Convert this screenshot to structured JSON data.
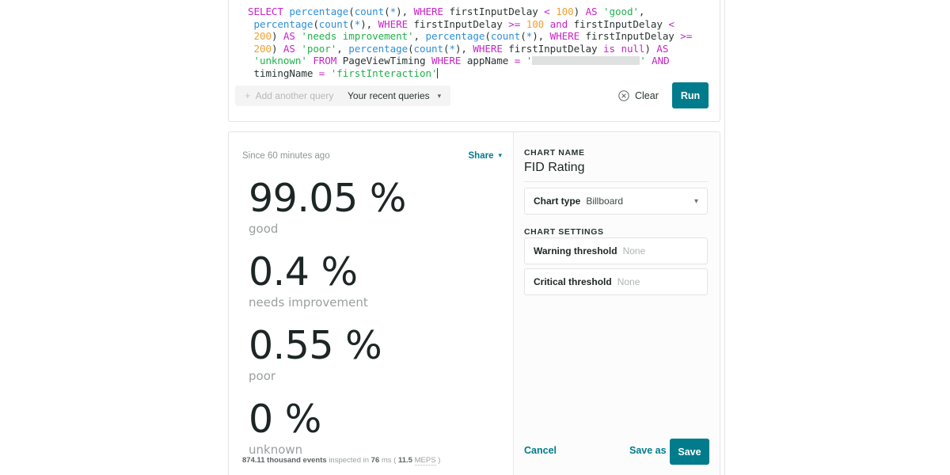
{
  "query_editor": {
    "code_tokens": [
      {
        "t": "SELECT",
        "c": "kw"
      },
      {
        "t": " ",
        "c": "plain"
      },
      {
        "t": "percentage",
        "c": "fn"
      },
      {
        "t": "(",
        "c": "plain"
      },
      {
        "t": "count",
        "c": "fn"
      },
      {
        "t": "(",
        "c": "plain"
      },
      {
        "t": "*",
        "c": "star"
      },
      {
        "t": "), ",
        "c": "plain"
      },
      {
        "t": "WHERE",
        "c": "kw"
      },
      {
        "t": " firstInputDelay ",
        "c": "plain"
      },
      {
        "t": "<",
        "c": "op"
      },
      {
        "t": " ",
        "c": "plain"
      },
      {
        "t": "100",
        "c": "num"
      },
      {
        "t": ") ",
        "c": "plain"
      },
      {
        "t": "AS",
        "c": "kw"
      },
      {
        "t": " ",
        "c": "plain"
      },
      {
        "t": "'good'",
        "c": "str"
      },
      {
        "t": ",\n ",
        "c": "plain"
      },
      {
        "t": "percentage",
        "c": "fn"
      },
      {
        "t": "(",
        "c": "plain"
      },
      {
        "t": "count",
        "c": "fn"
      },
      {
        "t": "(",
        "c": "plain"
      },
      {
        "t": "*",
        "c": "star"
      },
      {
        "t": "), ",
        "c": "plain"
      },
      {
        "t": "WHERE",
        "c": "kw"
      },
      {
        "t": " firstInputDelay ",
        "c": "plain"
      },
      {
        "t": ">=",
        "c": "op"
      },
      {
        "t": " ",
        "c": "plain"
      },
      {
        "t": "100",
        "c": "num"
      },
      {
        "t": " and",
        "c": "kw"
      },
      {
        "t": " firstInputDelay ",
        "c": "plain"
      },
      {
        "t": "<",
        "c": "op"
      },
      {
        "t": "\n ",
        "c": "plain"
      },
      {
        "t": "200",
        "c": "num"
      },
      {
        "t": ") ",
        "c": "plain"
      },
      {
        "t": "AS",
        "c": "kw"
      },
      {
        "t": " ",
        "c": "plain"
      },
      {
        "t": "'needs improvement'",
        "c": "str"
      },
      {
        "t": ", ",
        "c": "plain"
      },
      {
        "t": "percentage",
        "c": "fn"
      },
      {
        "t": "(",
        "c": "plain"
      },
      {
        "t": "count",
        "c": "fn"
      },
      {
        "t": "(",
        "c": "plain"
      },
      {
        "t": "*",
        "c": "star"
      },
      {
        "t": "), ",
        "c": "plain"
      },
      {
        "t": "WHERE",
        "c": "kw"
      },
      {
        "t": " firstInputDelay ",
        "c": "plain"
      },
      {
        "t": ">=",
        "c": "op"
      },
      {
        "t": "\n ",
        "c": "plain"
      },
      {
        "t": "200",
        "c": "num"
      },
      {
        "t": ") ",
        "c": "plain"
      },
      {
        "t": "AS",
        "c": "kw"
      },
      {
        "t": " ",
        "c": "plain"
      },
      {
        "t": "'poor'",
        "c": "str"
      },
      {
        "t": ", ",
        "c": "plain"
      },
      {
        "t": "percentage",
        "c": "fn"
      },
      {
        "t": "(",
        "c": "plain"
      },
      {
        "t": "count",
        "c": "fn"
      },
      {
        "t": "(",
        "c": "plain"
      },
      {
        "t": "*",
        "c": "star"
      },
      {
        "t": "), ",
        "c": "plain"
      },
      {
        "t": "WHERE",
        "c": "kw"
      },
      {
        "t": " firstInputDelay ",
        "c": "plain"
      },
      {
        "t": "is null",
        "c": "kw"
      },
      {
        "t": ") ",
        "c": "plain"
      },
      {
        "t": "AS",
        "c": "kw"
      },
      {
        "t": "\n ",
        "c": "plain"
      },
      {
        "t": "'unknown'",
        "c": "str"
      },
      {
        "t": " ",
        "c": "plain"
      },
      {
        "t": "FROM",
        "c": "kw"
      },
      {
        "t": " PageViewTiming ",
        "c": "plain"
      },
      {
        "t": "WHERE",
        "c": "kw"
      },
      {
        "t": " appName ",
        "c": "plain"
      },
      {
        "t": "=",
        "c": "op"
      },
      {
        "t": " ",
        "c": "plain"
      },
      {
        "t": "'",
        "c": "str"
      },
      {
        "t": "[REDACTED]",
        "c": "redacted"
      },
      {
        "t": "'",
        "c": "str"
      },
      {
        "t": " ",
        "c": "plain"
      },
      {
        "t": "AND",
        "c": "kw"
      },
      {
        "t": "\n timingName ",
        "c": "plain"
      },
      {
        "t": "=",
        "c": "op"
      },
      {
        "t": " ",
        "c": "plain"
      },
      {
        "t": "'firstInteraction'",
        "c": "str"
      },
      {
        "t": "[CARET]",
        "c": "caret"
      }
    ],
    "plain_text": "SELECT percentage(count(*), WHERE firstInputDelay < 100) AS 'good', percentage(count(*), WHERE firstInputDelay >= 100 and firstInputDelay < 200) AS 'needs improvement', percentage(count(*), WHERE firstInputDelay >= 200) AS 'poor', percentage(count(*), WHERE firstInputDelay is null) AS 'unknown' FROM PageViewTiming WHERE appName = '' AND timingName = 'firstInteraction'",
    "toolbar": {
      "add_query_label": "Add another query",
      "add_query_icon": "plus-icon",
      "recent_queries_label": "Your recent queries",
      "recent_queries_chevron": "chevron-down-icon",
      "clear_label": "Clear",
      "clear_icon": "circle-x-icon",
      "run_label": "Run"
    }
  },
  "preview": {
    "since_label": "Since 60 minutes ago",
    "share_label": "Share",
    "share_chevron": "chevron-down-icon",
    "billboards": [
      {
        "value": "99.05 %",
        "label": "good"
      },
      {
        "value": "0.4 %",
        "label": "needs improvement"
      },
      {
        "value": "0.55 %",
        "label": "poor"
      },
      {
        "value": "0 %",
        "label": "unknown"
      }
    ],
    "footer": {
      "events_count": "874.11 thousand events",
      "inspected_text": "inspected in",
      "duration": "76",
      "duration_unit": "ms",
      "open_paren": "(",
      "rate": "11.5",
      "rate_unit": "MEPS",
      "close_paren": ")"
    }
  },
  "settings": {
    "chart_name_section_label": "CHART NAME",
    "chart_name_value": "FID Rating",
    "chart_type_label": "Chart type",
    "chart_type_value": "Billboard",
    "chart_type_chevron": "chevron-down-icon",
    "chart_settings_section_label": "CHART SETTINGS",
    "warning_threshold_label": "Warning threshold",
    "warning_threshold_value": "None",
    "critical_threshold_label": "Critical threshold",
    "critical_threshold_value": "None",
    "cancel_label": "Cancel",
    "save_as_label": "Save as",
    "save_label": "Save"
  },
  "colors": {
    "accent_teal": "#017c8c",
    "keyword_magenta": "#c724c7",
    "function_blue": "#2e8fd8",
    "string_green": "#22b14c",
    "number_orange": "#f0a030",
    "text_dark": "#1d2525",
    "text_muted": "#9a9fa0",
    "border": "#e3e4e4",
    "sidebar_bg": "#fcfcfc"
  }
}
